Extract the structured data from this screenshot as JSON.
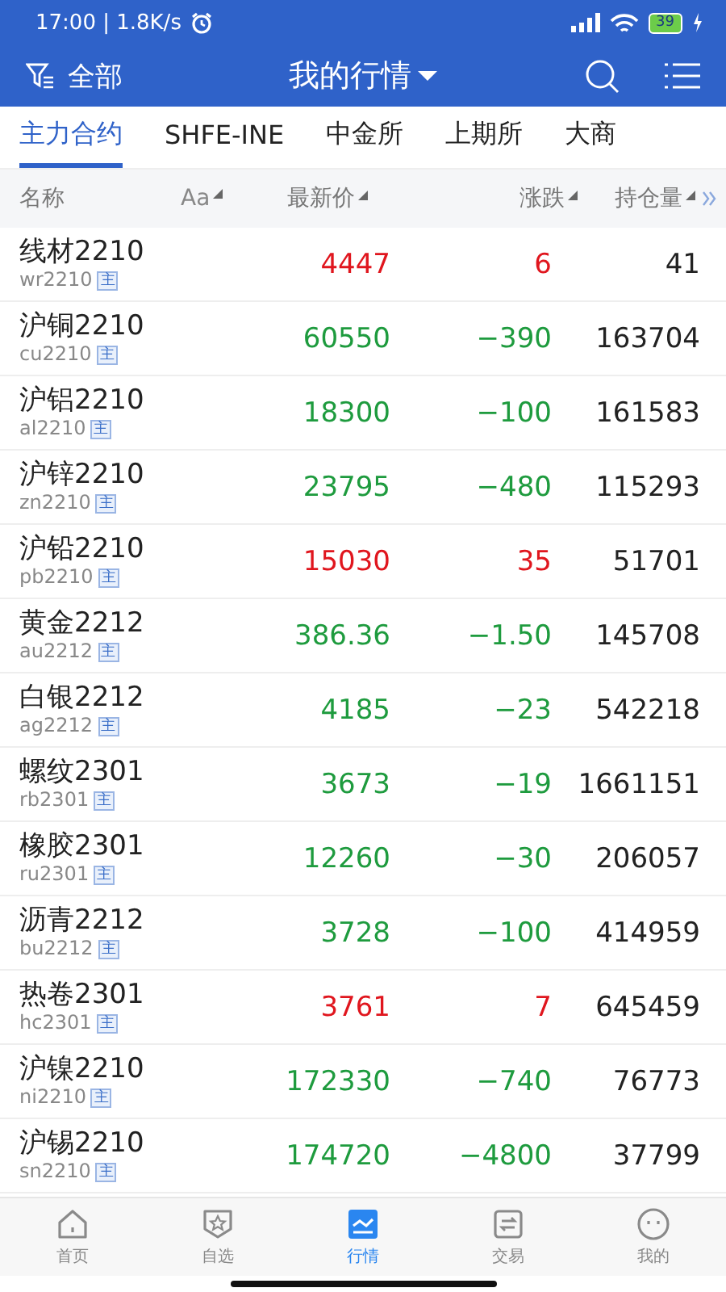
{
  "status_bar": {
    "time": "17:00 | 1.8K/s",
    "battery": "39"
  },
  "header": {
    "filter": "全部",
    "title": "我的行情"
  },
  "tabs": [
    {
      "label": "主力合约",
      "selected": true
    },
    {
      "label": "SHFE-INE",
      "selected": false
    },
    {
      "label": "中金所",
      "selected": false
    },
    {
      "label": "上期所",
      "selected": false
    },
    {
      "label": "大商",
      "selected": false
    }
  ],
  "table": {
    "columns": [
      "名称",
      "Aa",
      "最新价",
      "涨跌",
      "持仓量"
    ],
    "rows": [
      {
        "name": "线材2210",
        "code": "wr2210",
        "badge": "主",
        "price": "4447",
        "change": "6",
        "open_interest": "41",
        "kind": "up"
      },
      {
        "name": "沪铜2210",
        "code": "cu2210",
        "badge": "主",
        "price": "60550",
        "change": "−390",
        "open_interest": "163704",
        "kind": "down"
      },
      {
        "name": "沪铝2210",
        "code": "al2210",
        "badge": "主",
        "price": "18300",
        "change": "−100",
        "open_interest": "161583",
        "kind": "down"
      },
      {
        "name": "沪锌2210",
        "code": "zn2210",
        "badge": "主",
        "price": "23795",
        "change": "−480",
        "open_interest": "115293",
        "kind": "down"
      },
      {
        "name": "沪铅2210",
        "code": "pb2210",
        "badge": "主",
        "price": "15030",
        "change": "35",
        "open_interest": "51701",
        "kind": "up"
      },
      {
        "name": "黄金2212",
        "code": "au2212",
        "badge": "主",
        "price": "386.36",
        "change": "−1.50",
        "open_interest": "145708",
        "kind": "down"
      },
      {
        "name": "白银2212",
        "code": "ag2212",
        "badge": "主",
        "price": "4185",
        "change": "−23",
        "open_interest": "542218",
        "kind": "down"
      },
      {
        "name": "螺纹2301",
        "code": "rb2301",
        "badge": "主",
        "price": "3673",
        "change": "−19",
        "open_interest": "1661151",
        "kind": "down"
      },
      {
        "name": "橡胶2301",
        "code": "ru2301",
        "badge": "主",
        "price": "12260",
        "change": "−30",
        "open_interest": "206057",
        "kind": "down"
      },
      {
        "name": "沥青2212",
        "code": "bu2212",
        "badge": "主",
        "price": "3728",
        "change": "−100",
        "open_interest": "414959",
        "kind": "down"
      },
      {
        "name": "热卷2301",
        "code": "hc2301",
        "badge": "主",
        "price": "3761",
        "change": "7",
        "open_interest": "645459",
        "kind": "up"
      },
      {
        "name": "沪镍2210",
        "code": "ni2210",
        "badge": "主",
        "price": "172330",
        "change": "−740",
        "open_interest": "76773",
        "kind": "down"
      },
      {
        "name": "沪锡2210",
        "code": "sn2210",
        "badge": "主",
        "price": "174720",
        "change": "−4800",
        "open_interest": "37799",
        "kind": "down"
      }
    ]
  },
  "bottom_nav": [
    {
      "label": "首页",
      "kind": "home",
      "selected": false
    },
    {
      "label": "自选",
      "kind": "star",
      "selected": false
    },
    {
      "label": "行情",
      "kind": "chart",
      "selected": true
    },
    {
      "label": "交易",
      "kind": "swap",
      "selected": false
    },
    {
      "label": "我的",
      "kind": "face",
      "selected": false
    }
  ]
}
